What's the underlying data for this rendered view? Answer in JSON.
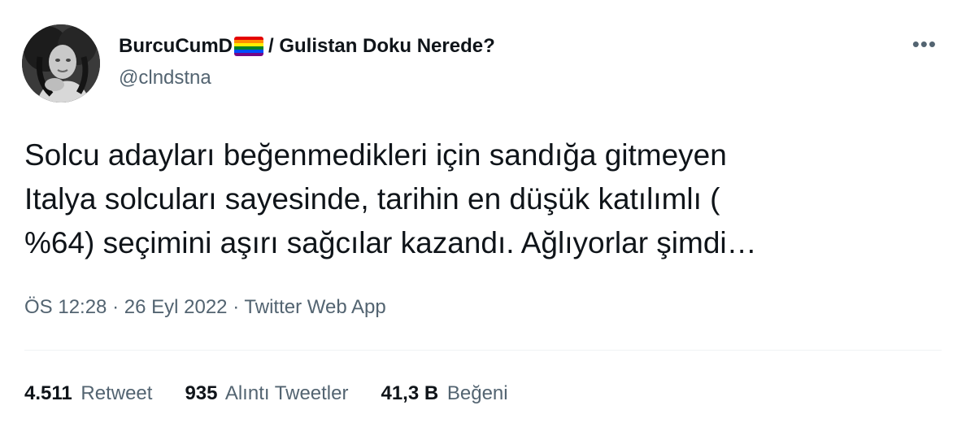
{
  "author": {
    "display_name": "BurcuCumD",
    "flag_icon": "rainbow-flag-icon",
    "name_suffix": "/ Gulistan Doku Nerede?",
    "handle": "@clndstna"
  },
  "more_icon": "more-options-icon",
  "tweet": {
    "text": "Solcu adayları beğenmedikleri için sandığa gitmeyen\nItalya solcuları sayesinde, tarihin en düşük katılımlı (\n%64) seçimini aşırı sağcılar kazandı. Ağlıyorlar şimdi…"
  },
  "meta": {
    "time": "ÖS 12:28",
    "separator": "·",
    "date": "26 Eyl 2022",
    "source": "Twitter Web App"
  },
  "stats": {
    "retweets": {
      "count": "4.511",
      "label": "Retweet"
    },
    "quotes": {
      "count": "935",
      "label": "Alıntı Tweetler"
    },
    "likes": {
      "count": "41,3 B",
      "label": "Beğeni"
    }
  },
  "colors": {
    "text_primary": "#0f1419",
    "text_secondary": "#536471",
    "divider": "#eff3f4",
    "flag": [
      "#e40303",
      "#ff8c00",
      "#ffed00",
      "#008026",
      "#004dff",
      "#750787"
    ]
  }
}
